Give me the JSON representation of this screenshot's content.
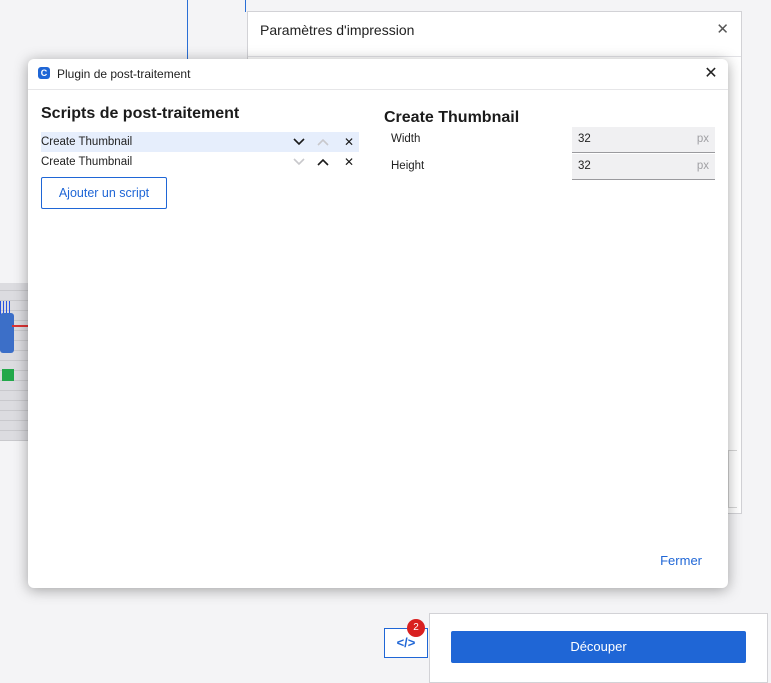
{
  "print_settings": {
    "title": "Paramètres d'impression"
  },
  "dialog": {
    "title": "Plugin de post-traitement",
    "scripts_heading": "Scripts de post-traitement",
    "scripts": [
      {
        "name": "Create Thumbnail",
        "selected": true
      },
      {
        "name": "Create Thumbnail",
        "selected": false
      }
    ],
    "add_script_label": "Ajouter un script",
    "settings_heading": "Create Thumbnail",
    "fields": [
      {
        "label": "Width",
        "value": "32",
        "unit": "px"
      },
      {
        "label": "Height",
        "value": "32",
        "unit": "px"
      }
    ],
    "close_label": "Fermer"
  },
  "bottom": {
    "badge_count": "2",
    "slice_label": "Découper"
  },
  "colors": {
    "accent": "#1f66d6",
    "badge": "#d92020"
  },
  "icons": {
    "app": "cura-logo-icon",
    "close": "close-icon",
    "move_down": "chevron-down-icon",
    "move_up": "chevron-up-icon",
    "remove": "remove-x-icon",
    "post_processing": "code-brackets-icon"
  }
}
